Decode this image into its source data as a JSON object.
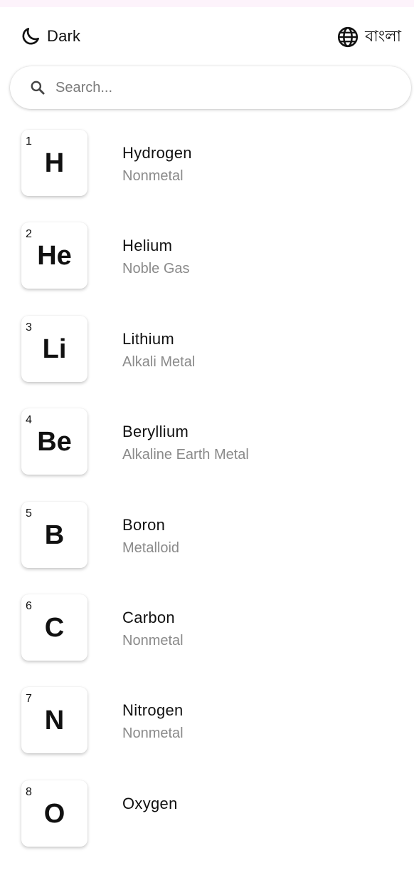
{
  "header": {
    "theme_label": "Dark",
    "theme_icon": "moon-icon",
    "language_label": "বাংলা",
    "language_icon": "globe-icon"
  },
  "search": {
    "placeholder": "Search...",
    "value": "",
    "icon": "search-icon"
  },
  "elements": [
    {
      "number": "1",
      "symbol": "H",
      "name": "Hydrogen",
      "category": "Nonmetal"
    },
    {
      "number": "2",
      "symbol": "He",
      "name": "Helium",
      "category": "Noble Gas"
    },
    {
      "number": "3",
      "symbol": "Li",
      "name": "Lithium",
      "category": "Alkali Metal"
    },
    {
      "number": "4",
      "symbol": "Be",
      "name": "Beryllium",
      "category": "Alkaline Earth Metal"
    },
    {
      "number": "5",
      "symbol": "B",
      "name": "Boron",
      "category": "Metalloid"
    },
    {
      "number": "6",
      "symbol": "C",
      "name": "Carbon",
      "category": "Nonmetal"
    },
    {
      "number": "7",
      "symbol": "N",
      "name": "Nitrogen",
      "category": "Nonmetal"
    },
    {
      "number": "8",
      "symbol": "O",
      "name": "Oxygen",
      "category": ""
    }
  ],
  "colors": {
    "background": "#ffffff",
    "text_primary": "#111111",
    "text_secondary": "#8a8a8a",
    "status_strip": "#fdf3fb"
  }
}
